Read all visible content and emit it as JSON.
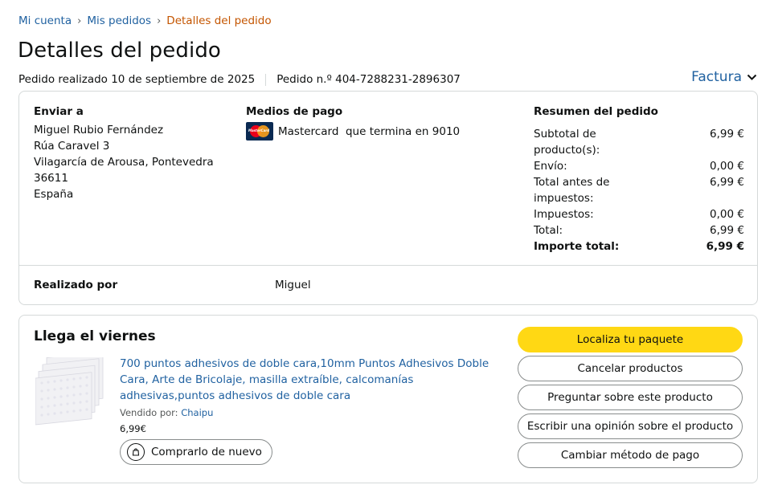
{
  "breadcrumb": {
    "account": "Mi cuenta",
    "orders": "Mis pedidos",
    "current": "Detalles del pedido",
    "separator": "›"
  },
  "page_title": "Detalles del pedido",
  "order_meta": {
    "placed": "Pedido realizado 10 de septiembre de 2025",
    "number": "Pedido n.º 404-7288231-2896307"
  },
  "invoice_label": "Factura",
  "shipping": {
    "title": "Enviar a",
    "name": "Miguel Rubio Fernández",
    "street": "Rúa Caravel 3",
    "city": "Vilagarcía de Arousa, Pontevedra",
    "postal": "36611",
    "country": "España"
  },
  "payment": {
    "title": "Medios de pago",
    "method": "Mastercard  que termina en 9010",
    "icon": "mastercard-icon",
    "brand_text": "MasterCard"
  },
  "summary": {
    "title": "Resumen del pedido",
    "rows": [
      {
        "label": "Subtotal de producto(s):",
        "value": "6,99 €"
      },
      {
        "label": "Envío:",
        "value": "0,00 €"
      },
      {
        "label": "Total antes de impuestos:",
        "value": "6,99 €"
      },
      {
        "label": "Impuestos:",
        "value": "0,00 €"
      },
      {
        "label": "Total:",
        "value": "6,99 €"
      }
    ],
    "grand_total_label": "Importe total:",
    "grand_total_value": "6,99 €"
  },
  "placed_by": {
    "label": "Realizado por",
    "value": "Miguel"
  },
  "shipment": {
    "arrival": "Llega el viernes",
    "product_title": "700 puntos adhesivos de doble cara,10mm Puntos Adhesivos Doble Cara, Arte de Bricolaje, masilla extraíble, calcomanías adhesivas,puntos adhesivos de doble cara",
    "seller_prefix": "Vendido por:",
    "seller_name": "Chaipu",
    "price": "6,99€",
    "buy_again": "Comprarlo de nuevo"
  },
  "actions": {
    "track": "Localiza tu paquete",
    "cancel": "Cancelar productos",
    "ask": "Preguntar sobre este producto",
    "review": "Escribir una opinión sobre el producto",
    "change_payment": "Cambiar método de pago"
  },
  "colors": {
    "link": "#2162a1",
    "breadcrumb_current": "#c45500",
    "primary_button": "#ffd814",
    "border": "#d5d9d9"
  }
}
